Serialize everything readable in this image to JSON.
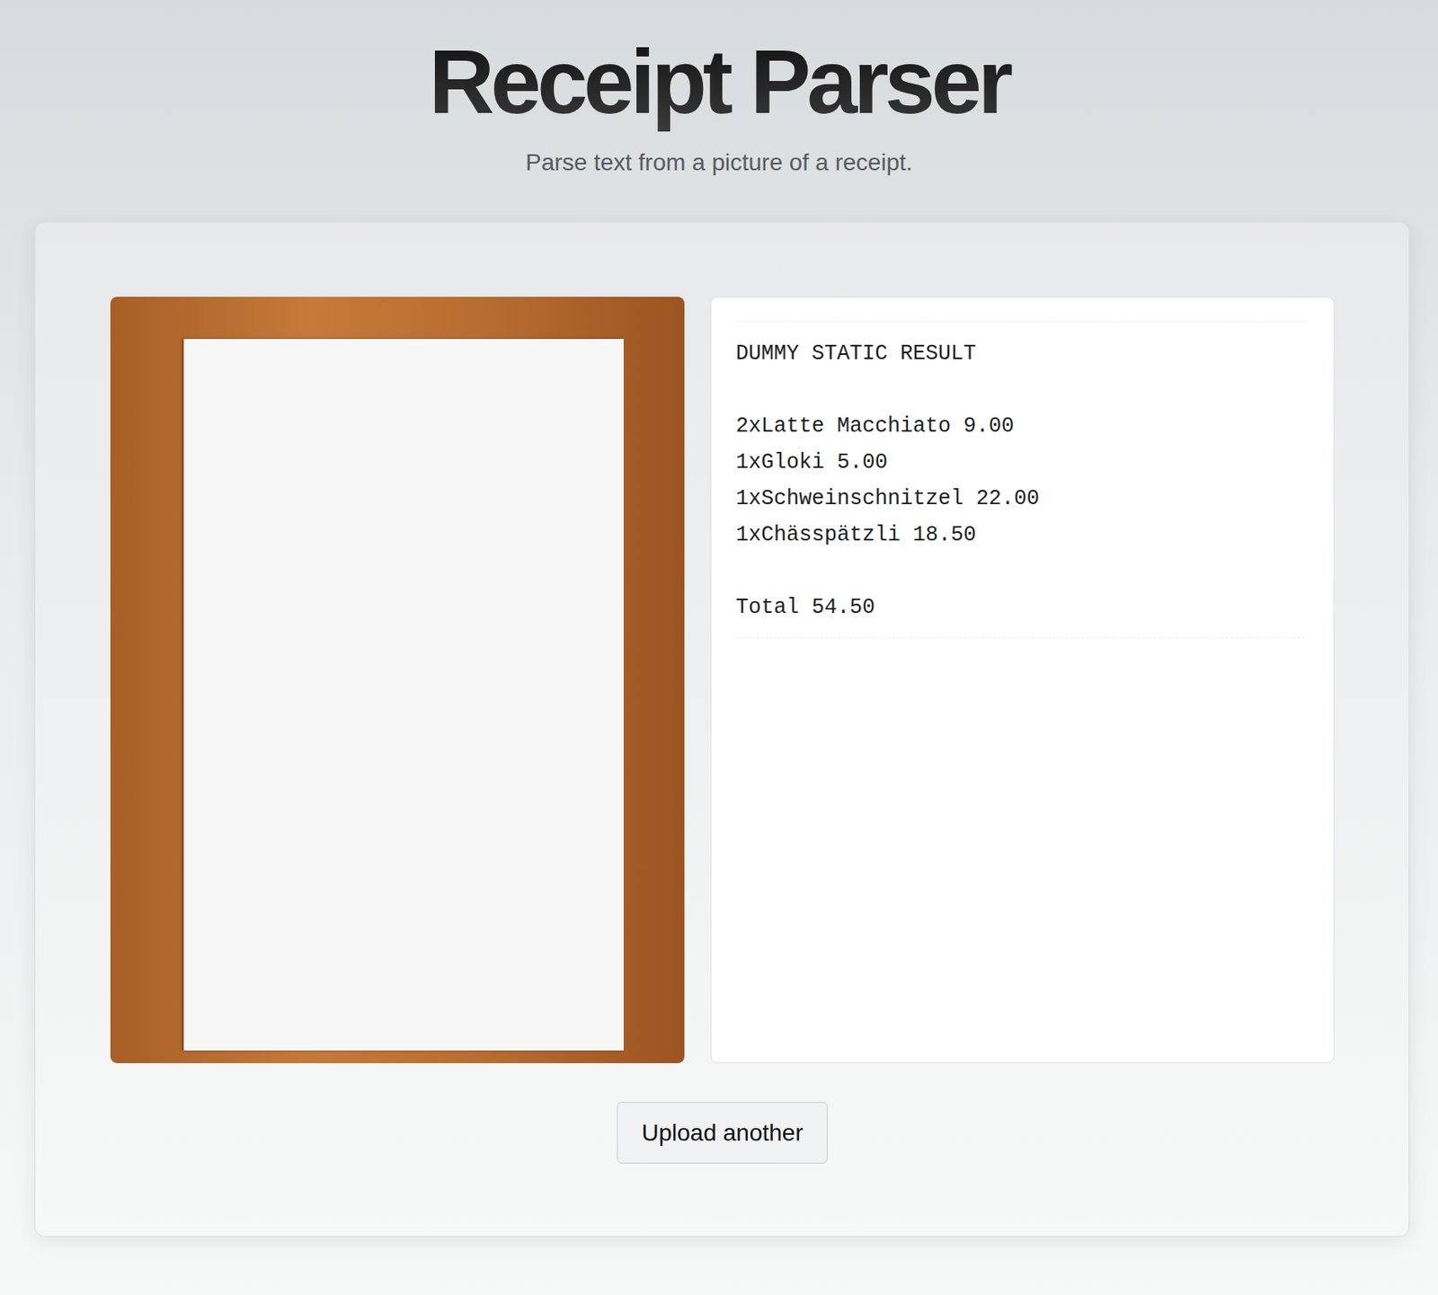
{
  "header": {
    "title": "Receipt Parser",
    "subtitle": "Parse text from a picture of a receipt."
  },
  "result": {
    "heading": "DUMMY STATIC RESULT",
    "items": [
      "2xLatte Macchiato 9.00",
      "1xGloki 5.00",
      "1xSchweinschnitzel 22.00",
      "1xChässpätzli 18.50"
    ],
    "total": "Total 54.50"
  },
  "buttons": [
    "Upload another"
  ]
}
